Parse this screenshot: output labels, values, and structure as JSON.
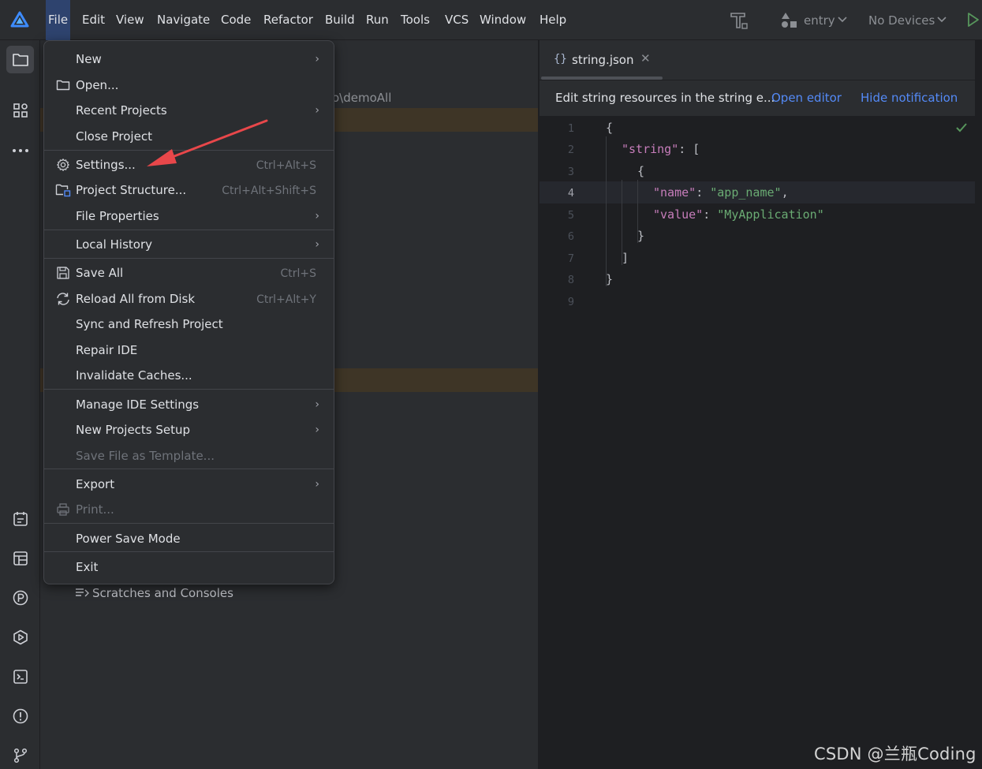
{
  "menubar": {
    "items": [
      "File",
      "Edit",
      "View",
      "Navigate",
      "Code",
      "Refactor",
      "Build",
      "Run",
      "Tools",
      "VCS",
      "Window",
      "Help"
    ],
    "module": "entry",
    "devices": "No Devices"
  },
  "project": {
    "path_fragment": "o\\demoAll",
    "scratches": "Scratches and Consoles"
  },
  "editor": {
    "tab_icon": "{}",
    "tab_label": "string.json",
    "tab_close": "✕",
    "notification": {
      "text": "Edit string resources in the string e...",
      "open_editor": "Open editor",
      "hide": "Hide notification"
    },
    "line_numbers": [
      "1",
      "2",
      "3",
      "4",
      "5",
      "6",
      "7",
      "8",
      "9"
    ],
    "code": {
      "l1": "{",
      "l2_key": "\"string\"",
      "l2_rest": ": [",
      "l3": "{",
      "l4_key": "\"name\"",
      "l4_colon": ": ",
      "l4_val": "\"app_name\"",
      "l4_comma": ",",
      "l5_key": "\"value\"",
      "l5_colon": ": ",
      "l5_val": "\"MyApplication\"",
      "l6": "}",
      "l7": "]",
      "l8": "}"
    }
  },
  "file_menu": {
    "new": "New",
    "open": "Open...",
    "recent": "Recent Projects",
    "close": "Close Project",
    "settings": "Settings...",
    "settings_sc": "Ctrl+Alt+S",
    "structure": "Project Structure...",
    "structure_sc": "Ctrl+Alt+Shift+S",
    "file_props": "File Properties",
    "local_history": "Local History",
    "save_all": "Save All",
    "save_all_sc": "Ctrl+S",
    "reload": "Reload All from Disk",
    "reload_sc": "Ctrl+Alt+Y",
    "sync": "Sync and Refresh Project",
    "repair": "Repair IDE",
    "invalidate": "Invalidate Caches...",
    "manage": "Manage IDE Settings",
    "new_setup": "New Projects Setup",
    "save_template": "Save File as Template...",
    "export": "Export",
    "print": "Print...",
    "power_save": "Power Save Mode",
    "exit": "Exit",
    "submenu_arrow": "›"
  },
  "watermark": "CSDN @兰瓶Coding",
  "colors": {
    "accent": "#548af7",
    "active_menu": "#2e436e",
    "highlight_row": "#3e3526",
    "annotation": "#e8474a",
    "json_key": "#c77dbb",
    "json_string": "#6aab73"
  }
}
